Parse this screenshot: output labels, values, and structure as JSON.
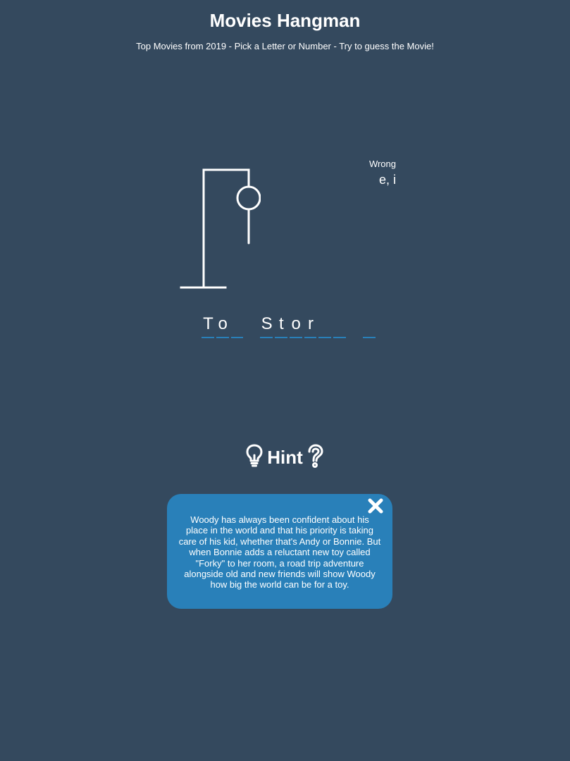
{
  "header": {
    "title": "Movies Hangman",
    "subtitle": "Top Movies from 2019 - Pick a Letter or Number - Try to guess the Movie!"
  },
  "wrong": {
    "label": "Wrong",
    "letters": "e, i"
  },
  "puzzle": {
    "words": [
      [
        "T",
        "o",
        ""
      ],
      [
        "S",
        "t",
        "o",
        "r",
        "",
        ""
      ],
      [
        ""
      ]
    ]
  },
  "hint": {
    "label": "Hint",
    "text": "Woody has always been confident about his place in the world and that his priority is taking care of his kid, whether that's Andy or Bonnie. But when Bonnie adds a reluctant new toy called \"Forky\" to her room, a road trip adventure alongside old and new friends will show Woody how big the world can be for a toy.",
    "left_icon": "lightbulb-icon",
    "right_icon": "question-icon",
    "close_icon": "close-icon"
  },
  "colors": {
    "background": "#34495e",
    "accent": "#2980b9",
    "text": "#ffffff"
  },
  "hangman": {
    "wrong_guesses": 2,
    "parts_shown": [
      "head",
      "body"
    ]
  }
}
